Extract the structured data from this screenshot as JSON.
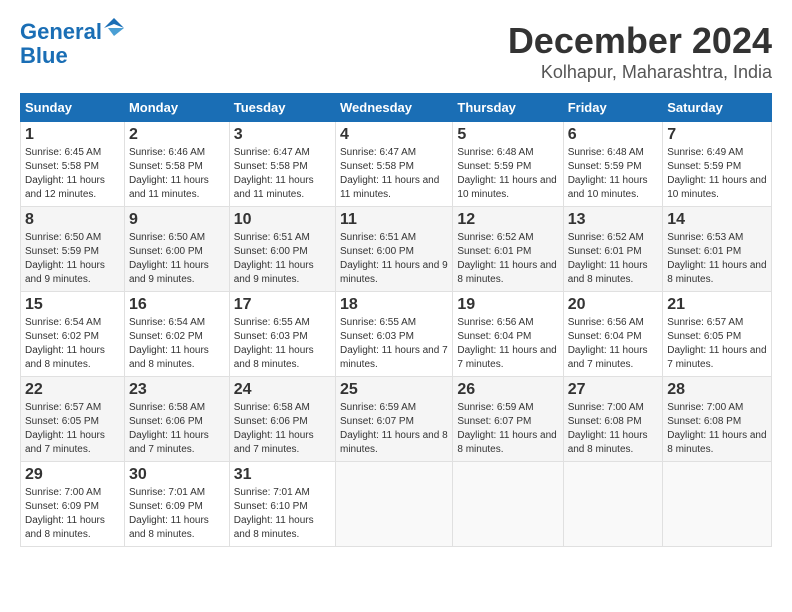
{
  "logo": {
    "line1": "General",
    "line2": "Blue"
  },
  "title": "December 2024",
  "location": "Kolhapur, Maharashtra, India",
  "days_of_week": [
    "Sunday",
    "Monday",
    "Tuesday",
    "Wednesday",
    "Thursday",
    "Friday",
    "Saturday"
  ],
  "weeks": [
    [
      {
        "day": "1",
        "sunrise": "6:45 AM",
        "sunset": "5:58 PM",
        "daylight": "11 hours and 12 minutes."
      },
      {
        "day": "2",
        "sunrise": "6:46 AM",
        "sunset": "5:58 PM",
        "daylight": "11 hours and 11 minutes."
      },
      {
        "day": "3",
        "sunrise": "6:47 AM",
        "sunset": "5:58 PM",
        "daylight": "11 hours and 11 minutes."
      },
      {
        "day": "4",
        "sunrise": "6:47 AM",
        "sunset": "5:58 PM",
        "daylight": "11 hours and 11 minutes."
      },
      {
        "day": "5",
        "sunrise": "6:48 AM",
        "sunset": "5:59 PM",
        "daylight": "11 hours and 10 minutes."
      },
      {
        "day": "6",
        "sunrise": "6:48 AM",
        "sunset": "5:59 PM",
        "daylight": "11 hours and 10 minutes."
      },
      {
        "day": "7",
        "sunrise": "6:49 AM",
        "sunset": "5:59 PM",
        "daylight": "11 hours and 10 minutes."
      }
    ],
    [
      {
        "day": "8",
        "sunrise": "6:50 AM",
        "sunset": "5:59 PM",
        "daylight": "11 hours and 9 minutes."
      },
      {
        "day": "9",
        "sunrise": "6:50 AM",
        "sunset": "6:00 PM",
        "daylight": "11 hours and 9 minutes."
      },
      {
        "day": "10",
        "sunrise": "6:51 AM",
        "sunset": "6:00 PM",
        "daylight": "11 hours and 9 minutes."
      },
      {
        "day": "11",
        "sunrise": "6:51 AM",
        "sunset": "6:00 PM",
        "daylight": "11 hours and 9 minutes."
      },
      {
        "day": "12",
        "sunrise": "6:52 AM",
        "sunset": "6:01 PM",
        "daylight": "11 hours and 8 minutes."
      },
      {
        "day": "13",
        "sunrise": "6:52 AM",
        "sunset": "6:01 PM",
        "daylight": "11 hours and 8 minutes."
      },
      {
        "day": "14",
        "sunrise": "6:53 AM",
        "sunset": "6:01 PM",
        "daylight": "11 hours and 8 minutes."
      }
    ],
    [
      {
        "day": "15",
        "sunrise": "6:54 AM",
        "sunset": "6:02 PM",
        "daylight": "11 hours and 8 minutes."
      },
      {
        "day": "16",
        "sunrise": "6:54 AM",
        "sunset": "6:02 PM",
        "daylight": "11 hours and 8 minutes."
      },
      {
        "day": "17",
        "sunrise": "6:55 AM",
        "sunset": "6:03 PM",
        "daylight": "11 hours and 8 minutes."
      },
      {
        "day": "18",
        "sunrise": "6:55 AM",
        "sunset": "6:03 PM",
        "daylight": "11 hours and 7 minutes."
      },
      {
        "day": "19",
        "sunrise": "6:56 AM",
        "sunset": "6:04 PM",
        "daylight": "11 hours and 7 minutes."
      },
      {
        "day": "20",
        "sunrise": "6:56 AM",
        "sunset": "6:04 PM",
        "daylight": "11 hours and 7 minutes."
      },
      {
        "day": "21",
        "sunrise": "6:57 AM",
        "sunset": "6:05 PM",
        "daylight": "11 hours and 7 minutes."
      }
    ],
    [
      {
        "day": "22",
        "sunrise": "6:57 AM",
        "sunset": "6:05 PM",
        "daylight": "11 hours and 7 minutes."
      },
      {
        "day": "23",
        "sunrise": "6:58 AM",
        "sunset": "6:06 PM",
        "daylight": "11 hours and 7 minutes."
      },
      {
        "day": "24",
        "sunrise": "6:58 AM",
        "sunset": "6:06 PM",
        "daylight": "11 hours and 7 minutes."
      },
      {
        "day": "25",
        "sunrise": "6:59 AM",
        "sunset": "6:07 PM",
        "daylight": "11 hours and 8 minutes."
      },
      {
        "day": "26",
        "sunrise": "6:59 AM",
        "sunset": "6:07 PM",
        "daylight": "11 hours and 8 minutes."
      },
      {
        "day": "27",
        "sunrise": "7:00 AM",
        "sunset": "6:08 PM",
        "daylight": "11 hours and 8 minutes."
      },
      {
        "day": "28",
        "sunrise": "7:00 AM",
        "sunset": "6:08 PM",
        "daylight": "11 hours and 8 minutes."
      }
    ],
    [
      {
        "day": "29",
        "sunrise": "7:00 AM",
        "sunset": "6:09 PM",
        "daylight": "11 hours and 8 minutes."
      },
      {
        "day": "30",
        "sunrise": "7:01 AM",
        "sunset": "6:09 PM",
        "daylight": "11 hours and 8 minutes."
      },
      {
        "day": "31",
        "sunrise": "7:01 AM",
        "sunset": "6:10 PM",
        "daylight": "11 hours and 8 minutes."
      },
      null,
      null,
      null,
      null
    ]
  ],
  "labels": {
    "sunrise": "Sunrise:",
    "sunset": "Sunset:",
    "daylight": "Daylight:"
  }
}
